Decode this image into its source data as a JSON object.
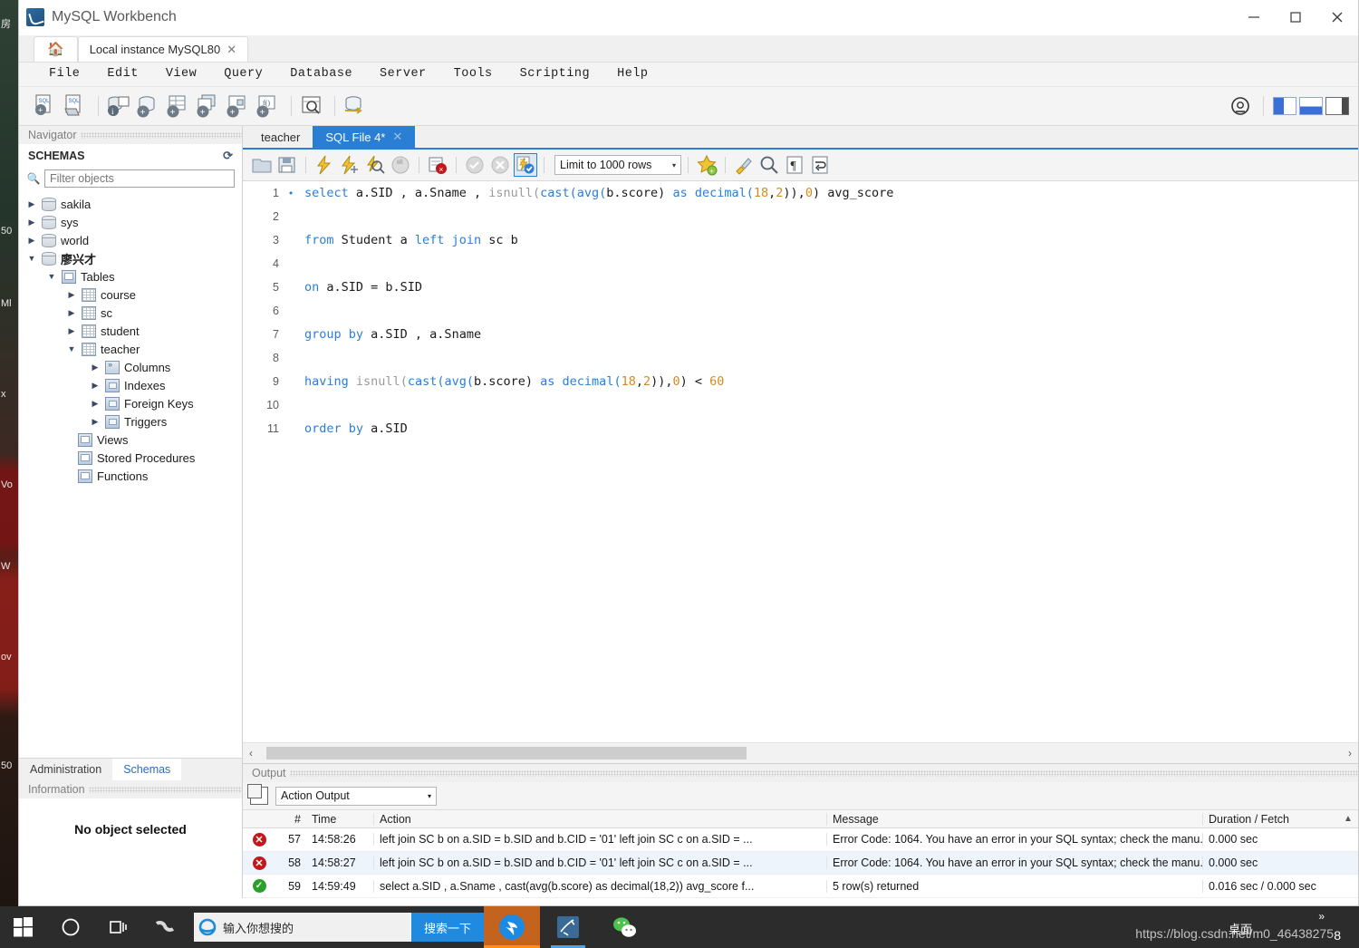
{
  "window": {
    "title": "MySQL Workbench",
    "app_icon": "mysql-dolphin-icon",
    "minimize": "–",
    "maximize": "□",
    "close": "✕"
  },
  "workspace_tabs": {
    "home_icon": "home-icon",
    "items": [
      {
        "label": "Local instance MySQL80",
        "close": "✕",
        "active": true
      }
    ]
  },
  "menubar": {
    "items": [
      "File",
      "Edit",
      "View",
      "Query",
      "Database",
      "Server",
      "Tools",
      "Scripting",
      "Help"
    ]
  },
  "main_toolbar": {
    "icons": [
      "new-sql-file-icon",
      "open-sql-file-icon",
      "connect-server-icon",
      "new-schema-icon",
      "new-table-icon",
      "new-view-icon",
      "new-procedure-icon",
      "new-function-icon",
      "inspect-schema-icon",
      "manage-connections-icon"
    ],
    "right_icons": [
      "help-icon",
      "sidebar-layout-icon",
      "output-layout-icon",
      "secondary-sidebar-icon"
    ]
  },
  "navigator": {
    "panel_title": "Navigator",
    "section_title": "SCHEMAS",
    "refresh_icon": "refresh-icon",
    "search_icon": "search-icon",
    "filter_placeholder": "Filter objects",
    "filter_value": "",
    "tree": [
      {
        "label": "sakila",
        "icon": "database-icon",
        "depth": 1,
        "expanded": false,
        "bold": false
      },
      {
        "label": "sys",
        "icon": "database-icon",
        "depth": 1,
        "expanded": false,
        "bold": false
      },
      {
        "label": "world",
        "icon": "database-icon",
        "depth": 1,
        "expanded": false,
        "bold": false
      },
      {
        "label": "廖兴才",
        "icon": "database-icon",
        "depth": 1,
        "expanded": true,
        "bold": true
      },
      {
        "label": "Tables",
        "icon": "tables-folder-icon",
        "depth": 2,
        "expanded": true,
        "bold": false
      },
      {
        "label": "course",
        "icon": "table-icon",
        "depth": 3,
        "expanded": false,
        "bold": false
      },
      {
        "label": "sc",
        "icon": "table-icon",
        "depth": 3,
        "expanded": false,
        "bold": false
      },
      {
        "label": "student",
        "icon": "table-icon",
        "depth": 3,
        "expanded": false,
        "bold": false
      },
      {
        "label": "teacher",
        "icon": "table-icon",
        "depth": 3,
        "expanded": true,
        "bold": false
      },
      {
        "label": "Columns",
        "icon": "columns-icon",
        "depth": 4,
        "expanded": false,
        "bold": false
      },
      {
        "label": "Indexes",
        "icon": "indexes-icon",
        "depth": 4,
        "expanded": false,
        "bold": false
      },
      {
        "label": "Foreign Keys",
        "icon": "foreign-keys-icon",
        "depth": 4,
        "expanded": false,
        "bold": false
      },
      {
        "label": "Triggers",
        "icon": "triggers-icon",
        "depth": 4,
        "expanded": false,
        "bold": false
      },
      {
        "label": "Views",
        "icon": "views-folder-icon",
        "depth": 2.5,
        "expanded": null,
        "bold": false
      },
      {
        "label": "Stored Procedures",
        "icon": "procedures-folder-icon",
        "depth": 2.5,
        "expanded": null,
        "bold": false
      },
      {
        "label": "Functions",
        "icon": "functions-folder-icon",
        "depth": 2.5,
        "expanded": null,
        "bold": false
      }
    ],
    "bottom_tabs": [
      {
        "label": "Administration",
        "active": false
      },
      {
        "label": "Schemas",
        "active": true
      }
    ],
    "information_title": "Information",
    "information_body": "No object selected"
  },
  "editor": {
    "tabs": [
      {
        "label": "teacher",
        "active": false,
        "closable": false
      },
      {
        "label": "SQL File 4*",
        "active": true,
        "closable": true,
        "close": "✕"
      }
    ],
    "toolbar": {
      "icons": [
        "open-script-icon",
        "save-script-icon",
        "execute-icon",
        "execute-current-statement-icon",
        "explain-icon",
        "stop-icon",
        "toggle-stop-on-error-icon",
        "commit-icon",
        "rollback-icon",
        "autocommit-icon"
      ],
      "limit_label": "Limit to 1000 rows",
      "limit_caret": "▾",
      "right_icons": [
        "snippets-icon",
        "beautify-icon",
        "find-icon",
        "invisible-chars-icon",
        "wrap-lines-icon"
      ]
    },
    "lines": [
      {
        "n": "1",
        "marker": "•",
        "tokens": [
          {
            "t": "select",
            "c": "kw"
          },
          {
            "t": " a.SID , a.Sname , ",
            "c": ""
          },
          {
            "t": "isnull(",
            "c": "fn"
          },
          {
            "t": "cast(",
            "c": "fn2"
          },
          {
            "t": "avg(",
            "c": "fn2"
          },
          {
            "t": "b.score) ",
            "c": ""
          },
          {
            "t": "as",
            "c": "kw"
          },
          {
            "t": " ",
            "c": ""
          },
          {
            "t": "decimal(",
            "c": "kw"
          },
          {
            "t": "18",
            "c": "num"
          },
          {
            "t": ",",
            "c": ""
          },
          {
            "t": "2",
            "c": "num"
          },
          {
            "t": ")),",
            "c": ""
          },
          {
            "t": "0",
            "c": "num"
          },
          {
            "t": ") avg_score",
            "c": ""
          }
        ]
      },
      {
        "n": "2",
        "marker": "",
        "tokens": []
      },
      {
        "n": "3",
        "marker": "",
        "tokens": [
          {
            "t": "from",
            "c": "kw"
          },
          {
            "t": " Student a ",
            "c": ""
          },
          {
            "t": "left join",
            "c": "kw"
          },
          {
            "t": " sc b",
            "c": ""
          }
        ]
      },
      {
        "n": "4",
        "marker": "",
        "tokens": []
      },
      {
        "n": "5",
        "marker": "",
        "tokens": [
          {
            "t": "on",
            "c": "kw"
          },
          {
            "t": " a.SID = b.SID",
            "c": ""
          }
        ]
      },
      {
        "n": "6",
        "marker": "",
        "tokens": []
      },
      {
        "n": "7",
        "marker": "",
        "tokens": [
          {
            "t": "group by",
            "c": "kw"
          },
          {
            "t": " a.SID , a.Sname",
            "c": ""
          }
        ]
      },
      {
        "n": "8",
        "marker": "",
        "tokens": []
      },
      {
        "n": "9",
        "marker": "",
        "tokens": [
          {
            "t": "having",
            "c": "kw"
          },
          {
            "t": " ",
            "c": ""
          },
          {
            "t": "isnull(",
            "c": "fn"
          },
          {
            "t": "cast(",
            "c": "fn2"
          },
          {
            "t": "avg(",
            "c": "fn2"
          },
          {
            "t": "b.score) ",
            "c": ""
          },
          {
            "t": "as",
            "c": "kw"
          },
          {
            "t": " ",
            "c": ""
          },
          {
            "t": "decimal(",
            "c": "kw"
          },
          {
            "t": "18",
            "c": "num"
          },
          {
            "t": ",",
            "c": ""
          },
          {
            "t": "2",
            "c": "num"
          },
          {
            "t": ")),",
            "c": ""
          },
          {
            "t": "0",
            "c": "num"
          },
          {
            "t": ") < ",
            "c": ""
          },
          {
            "t": "60",
            "c": "num"
          }
        ]
      },
      {
        "n": "10",
        "marker": "",
        "tokens": []
      },
      {
        "n": "11",
        "marker": "",
        "tokens": [
          {
            "t": "order by",
            "c": "kw"
          },
          {
            "t": " a.SID",
            "c": ""
          }
        ]
      }
    ],
    "hscroll": {
      "left_arrow": "‹",
      "right_arrow": "›"
    }
  },
  "output": {
    "panel_title": "Output",
    "copy_icon": "copy-icon",
    "selected_view": "Action Output",
    "view_caret": "▾",
    "columns": [
      "#",
      "Time",
      "Action",
      "Message",
      "Duration / Fetch"
    ],
    "scroll_up_icon": "▲",
    "rows": [
      {
        "status": "error",
        "status_glyph": "✕",
        "num": "57",
        "time": "14:58:26",
        "action": "left join SC b on a.SID = b.SID and b.CID = '01'  left join SC c on a.SID = ...",
        "message": "Error Code: 1064. You have an error in your SQL syntax; check the manu...",
        "duration": "0.000 sec"
      },
      {
        "status": "error",
        "status_glyph": "✕",
        "num": "58",
        "time": "14:58:27",
        "action": "left join SC b on a.SID = b.SID and b.CID = '01'  left join SC c on a.SID = ...",
        "message": "Error Code: 1064. You have an error in your SQL syntax; check the manu...",
        "duration": "0.000 sec"
      },
      {
        "status": "ok",
        "status_glyph": "✓",
        "num": "59",
        "time": "14:59:49",
        "action": "select a.SID , a.Sname , cast(avg(b.score) as decimal(18,2)) avg_score  f...",
        "message": "5 row(s) returned",
        "duration": "0.016 sec / 0.000 sec"
      }
    ]
  },
  "taskbar": {
    "start_icon": "windows-start-icon",
    "cortana_icon": "cortana-circle-icon",
    "taskview_icon": "task-view-icon",
    "sogou_icon": "sogou-pinyin-icon",
    "search": {
      "browser_icon": "internet-explorer-icon",
      "placeholder": "输入你想搜的",
      "value": "",
      "button_label": "搜索一下"
    },
    "apps": [
      {
        "icon": "dingtalk-icon",
        "active": true
      },
      {
        "icon": "mysql-workbench-icon",
        "active": false
      },
      {
        "icon": "wechat-icon",
        "active": false
      }
    ],
    "tray": {
      "desktop_label": "桌面",
      "overflow_icon": "»",
      "badge": "8"
    }
  },
  "watermark": {
    "text": "https://blog.csdn.net/m0_46438275"
  },
  "desktop_glyphs": [
    "房",
    "50",
    "Ml",
    "x",
    "Vo",
    "W",
    "ov",
    "50"
  ],
  "colors": {
    "accent_blue": "#2a7fd4",
    "keyword_blue": "#2a7fd4",
    "number_orange": "#d68a1f",
    "function_grey": "#9a9a9a",
    "error_red": "#c2181b",
    "success_green": "#2aa02a",
    "taskbar_bg": "#2c2c2c",
    "search_go_blue": "#1f8ae0"
  }
}
